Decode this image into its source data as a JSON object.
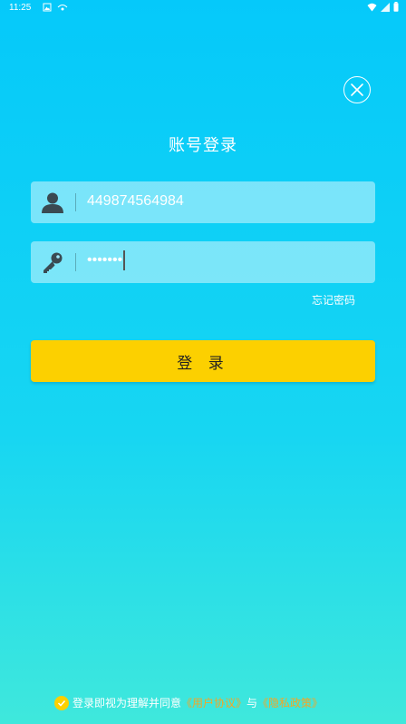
{
  "status_bar": {
    "time": "11:25",
    "left_icons": [
      "image-icon",
      "vpn-icon"
    ],
    "right_icons": [
      "wifi-icon",
      "signal-icon",
      "battery-icon"
    ]
  },
  "page": {
    "title": "账号登录"
  },
  "account": {
    "value": "449874564984",
    "icon": "user-icon"
  },
  "password": {
    "masked_value": "•••••••",
    "icon": "key-icon"
  },
  "forgot_password": "忘记密码",
  "login_button": "登 录",
  "agreement": {
    "prefix": "登录即视为理解并同意",
    "user_agreement": "《用户协议》",
    "conjunction": "与",
    "privacy_policy": "《隐私政策》"
  },
  "colors": {
    "accent": "#fcd000",
    "link": "#f5a623",
    "background_top": "#05c9fa",
    "background_bottom": "#3fe8dc"
  }
}
